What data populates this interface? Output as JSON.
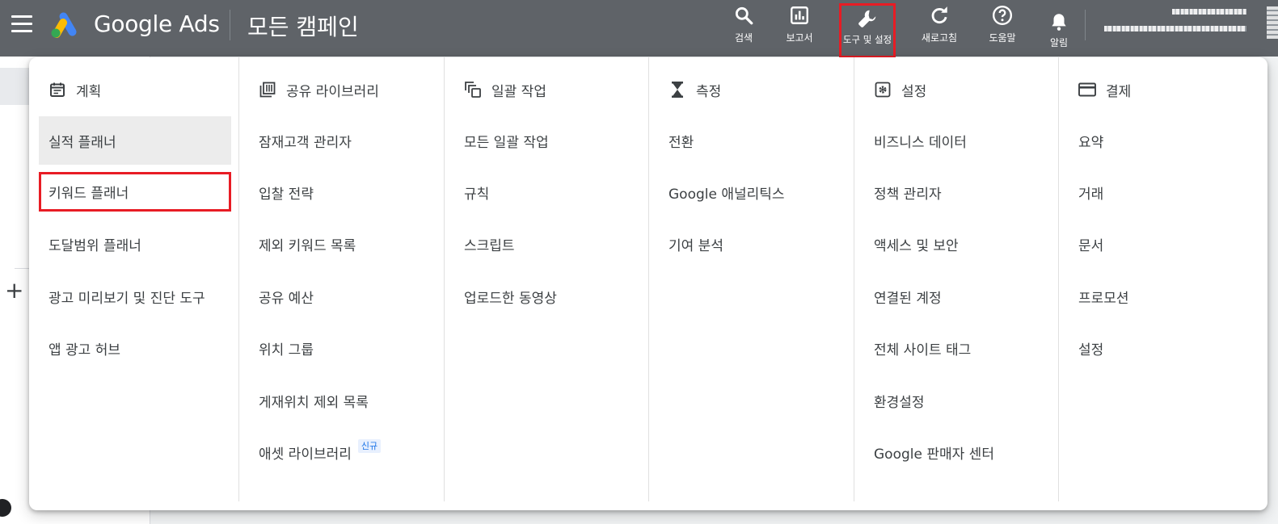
{
  "topbar": {
    "brand": "Google Ads",
    "page_title": "모든 캠페인",
    "tools": {
      "search": {
        "label": "검색",
        "icon": "search-icon"
      },
      "report": {
        "label": "보고서",
        "icon": "bar-chart-icon"
      },
      "settings": {
        "label": "도구 및 설정",
        "icon": "wrench-icon"
      },
      "refresh": {
        "label": "새로고침",
        "icon": "refresh-icon"
      },
      "help": {
        "label": "도움말",
        "icon": "help-icon"
      },
      "alert": {
        "label": "알림",
        "icon": "bell-icon"
      }
    },
    "highlight_color": "#e81c24"
  },
  "menu": {
    "columns": [
      {
        "title": "계획",
        "icon": "calendar-icon",
        "items": [
          "실적 플래너",
          "키워드 플래너",
          "도달범위 플래너",
          "광고 미리보기 및 진단 도구",
          "앱 광고 허브"
        ]
      },
      {
        "title": "공유 라이브러리",
        "icon": "library-icon",
        "items": [
          "잠재고객 관리자",
          "입찰 전략",
          "제외 키워드 목록",
          "공유 예산",
          "위치 그룹",
          "게재위치 제외 목록",
          "애셋 라이브러리"
        ],
        "badge": "신규"
      },
      {
        "title": "일괄 작업",
        "icon": "copy-icon",
        "items": [
          "모든 일괄 작업",
          "규칙",
          "스크립트",
          "업로드한 동영상"
        ]
      },
      {
        "title": "측정",
        "icon": "hourglass-icon",
        "items": [
          "전환",
          "Google 애널리틱스",
          "기여 분석"
        ]
      },
      {
        "title": "설정",
        "icon": "gear-icon",
        "items": [
          "비즈니스 데이터",
          "정책 관리자",
          "액세스 및 보안",
          "연결된 계정",
          "전체 사이트 태그",
          "환경설정",
          "Google 판매자 센터"
        ]
      },
      {
        "title": "결제",
        "icon": "credit-card-icon",
        "items": [
          "요약",
          "거래",
          "문서",
          "프로모션",
          "설정"
        ]
      }
    ]
  },
  "leftnav": {
    "add": "+"
  }
}
